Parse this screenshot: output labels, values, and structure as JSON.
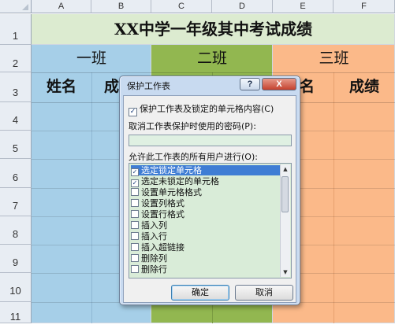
{
  "spreadsheet": {
    "columns": [
      "A",
      "B",
      "C",
      "D",
      "E",
      "F"
    ],
    "rows": [
      "1",
      "2",
      "3",
      "4",
      "5",
      "6",
      "7",
      "8",
      "9",
      "10",
      "11"
    ],
    "title": "XX中学一年级其中考试成绩",
    "class1": "一班",
    "class2": "二班",
    "class3": "三班",
    "name_header": "姓名",
    "score_header_partial": "成",
    "score_header_partial_right": "名",
    "score_header": "成绩",
    "colors": {
      "title_bg": "#dcebd0",
      "class1_bg": "#a6cfe8",
      "class2_bg": "#92b750",
      "class3_bg": "#fbb989"
    }
  },
  "dialog": {
    "title": "保护工作表",
    "help_label": "?",
    "close_label": "X",
    "protect_checkbox_label": "保护工作表及锁定的单元格内容(C)",
    "protect_checked": true,
    "password_label": "取消工作表保护时使用的密码(P):",
    "password_value": "",
    "allow_label": "允许此工作表的所有用户进行(O):",
    "permissions": [
      {
        "label": "选定锁定单元格",
        "checked": true,
        "selected": true
      },
      {
        "label": "选定未锁定的单元格",
        "checked": true,
        "selected": false
      },
      {
        "label": "设置单元格格式",
        "checked": false,
        "selected": false
      },
      {
        "label": "设置列格式",
        "checked": false,
        "selected": false
      },
      {
        "label": "设置行格式",
        "checked": false,
        "selected": false
      },
      {
        "label": "插入列",
        "checked": false,
        "selected": false
      },
      {
        "label": "插入行",
        "checked": false,
        "selected": false
      },
      {
        "label": "插入超链接",
        "checked": false,
        "selected": false
      },
      {
        "label": "删除列",
        "checked": false,
        "selected": false
      },
      {
        "label": "删除行",
        "checked": false,
        "selected": false
      }
    ],
    "ok_label": "确定",
    "cancel_label": "取消"
  }
}
